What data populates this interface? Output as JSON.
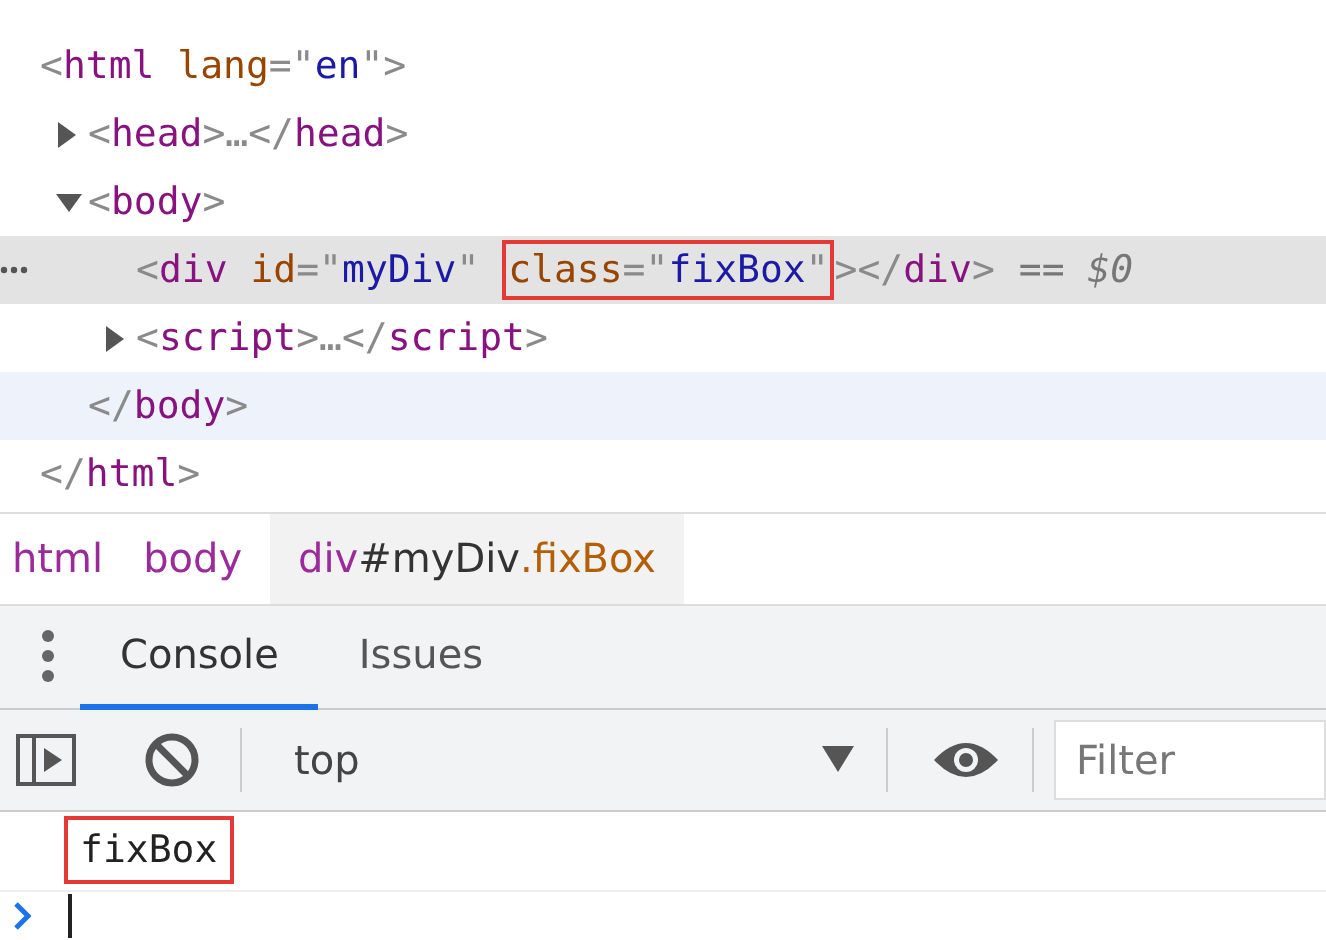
{
  "elements": {
    "root": {
      "selected": false,
      "hovered": false,
      "tokens": [
        {
          "kind": "punct",
          "text": "<"
        },
        {
          "kind": "tag",
          "text": "html"
        },
        {
          "kind": "attr",
          "text": " lang"
        },
        {
          "kind": "punct",
          "text": "=\""
        },
        {
          "kind": "value",
          "text": "en"
        },
        {
          "kind": "punct",
          "text": "\">"
        }
      ],
      "children": [
        {
          "expanded": false,
          "selected": false,
          "hovered": false,
          "tokens": [
            {
              "kind": "punct",
              "text": "<"
            },
            {
              "kind": "tag",
              "text": "head"
            },
            {
              "kind": "punct",
              "text": ">…</"
            },
            {
              "kind": "tag",
              "text": "head"
            },
            {
              "kind": "punct",
              "text": ">"
            }
          ]
        },
        {
          "expanded": true,
          "selected": false,
          "hovered": false,
          "tokens": [
            {
              "kind": "punct",
              "text": "<"
            },
            {
              "kind": "tag",
              "text": "body"
            },
            {
              "kind": "punct",
              "text": ">"
            }
          ],
          "children": [
            {
              "selected": true,
              "hovered": false,
              "tokens": [
                {
                  "kind": "punct",
                  "text": "<"
                },
                {
                  "kind": "tag",
                  "text": "div"
                },
                {
                  "kind": "attr",
                  "text": " id"
                },
                {
                  "kind": "punct",
                  "text": "=\""
                },
                {
                  "kind": "value",
                  "text": "myDiv"
                },
                {
                  "kind": "punct",
                  "text": "\" "
                },
                {
                  "kind": "boxed",
                  "tokens": [
                    {
                      "kind": "attr",
                      "text": "class"
                    },
                    {
                      "kind": "punct",
                      "text": "=\""
                    },
                    {
                      "kind": "value",
                      "text": "fixBox"
                    },
                    {
                      "kind": "punct",
                      "text": "\""
                    }
                  ]
                },
                {
                  "kind": "punct",
                  "text": "></"
                },
                {
                  "kind": "tag",
                  "text": "div"
                },
                {
                  "kind": "punct",
                  "text": ">"
                },
                {
                  "kind": "ref",
                  "text": "== $0"
                }
              ]
            },
            {
              "expanded": false,
              "selected": false,
              "hovered": false,
              "tokens": [
                {
                  "kind": "punct",
                  "text": "<"
                },
                {
                  "kind": "tag",
                  "text": "script"
                },
                {
                  "kind": "punct",
                  "text": ">…</"
                },
                {
                  "kind": "tag",
                  "text": "script"
                },
                {
                  "kind": "punct",
                  "text": ">"
                }
              ]
            }
          ],
          "close": {
            "selected": false,
            "hovered": true,
            "tokens": [
              {
                "kind": "punct",
                "text": "</"
              },
              {
                "kind": "tag",
                "text": "body"
              },
              {
                "kind": "punct",
                "text": ">"
              }
            ]
          }
        }
      ],
      "close": {
        "selected": false,
        "hovered": false,
        "tokens": [
          {
            "kind": "punct",
            "text": "</"
          },
          {
            "kind": "tag",
            "text": "html"
          },
          {
            "kind": "punct",
            "text": ">"
          }
        ]
      }
    }
  },
  "breadcrumbs": [
    {
      "tag": "html",
      "selected": false
    },
    {
      "tag": "body",
      "selected": false
    },
    {
      "tag": "div",
      "id": "#myDiv",
      "class": ".fixBox",
      "selected": true
    }
  ],
  "drawer_tabs": [
    {
      "label": "Console",
      "selected": true
    },
    {
      "label": "Issues",
      "selected": false
    }
  ],
  "console_toolbar": {
    "context": "top",
    "filter": {
      "placeholder": "Filter"
    }
  },
  "console_output": [
    {
      "text": "fixBox",
      "boxed": true
    }
  ]
}
